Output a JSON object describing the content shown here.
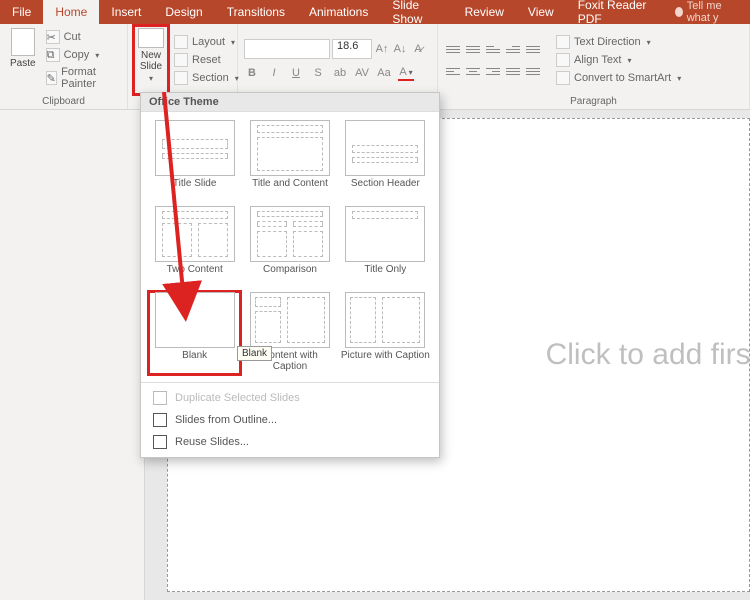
{
  "tabs": [
    "File",
    "Home",
    "Insert",
    "Design",
    "Transitions",
    "Animations",
    "Slide Show",
    "Review",
    "View",
    "Foxit Reader PDF"
  ],
  "active_tab": "Home",
  "tellme": "Tell me what y",
  "clipboard": {
    "paste": "Paste",
    "cut": "Cut",
    "copy": "Copy",
    "format_painter": "Format Painter",
    "group_label": "Clipboard"
  },
  "slides": {
    "new_slide": "New\nSlide",
    "layout": "Layout",
    "reset": "Reset",
    "section": "Section"
  },
  "font": {
    "size": "18.6"
  },
  "paragraph": {
    "group_label": "Paragraph",
    "text_direction": "Text Direction",
    "align_text": "Align Text",
    "convert_smartart": "Convert to SmartArt"
  },
  "gallery": {
    "header": "Office Theme",
    "layouts": [
      "Title Slide",
      "Title and Content",
      "Section Header",
      "Two Content",
      "Comparison",
      "Title Only",
      "Blank",
      "Content with Caption",
      "Picture with Caption"
    ],
    "tooltip": "Blank",
    "actions": {
      "duplicate": "Duplicate Selected Slides",
      "outline": "Slides from Outline...",
      "reuse": "Reuse Slides..."
    }
  },
  "canvas": {
    "placeholder": "Click to add first"
  }
}
